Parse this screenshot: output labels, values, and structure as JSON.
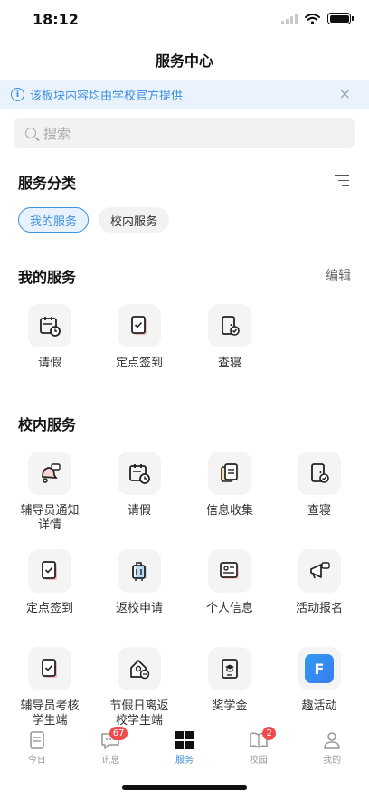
{
  "status": {
    "time": "18:12"
  },
  "header": {
    "title": "服务中心"
  },
  "notice": {
    "text": "该板块内容均由学校官方提供",
    "close": "×",
    "info": "i"
  },
  "search": {
    "placeholder": "搜索"
  },
  "category": {
    "title": "服务分类",
    "pills": [
      "我的服务",
      "校内服务"
    ]
  },
  "my_services": {
    "title": "我的服务",
    "edit_label": "编辑",
    "items": [
      "请假",
      "定点签到",
      "查寝"
    ]
  },
  "campus_services": {
    "title": "校内服务",
    "items": [
      "辅导员通知\n详情",
      "请假",
      "信息收集",
      "查寝",
      "定点签到",
      "返校申请",
      "个人信息",
      "活动报名",
      "辅导员考核\n学生端",
      "节假日离返\n校学生端",
      "奖学金",
      "趣活动"
    ],
    "app_icon_text": "F"
  },
  "tabbar": {
    "tabs": [
      {
        "label": "今日",
        "badge": ""
      },
      {
        "label": "讯息",
        "badge": "67"
      },
      {
        "label": "服务",
        "badge": ""
      },
      {
        "label": "校园",
        "badge": "2"
      },
      {
        "label": "我的",
        "badge": ""
      }
    ],
    "active_color": "#3d8fe0"
  }
}
